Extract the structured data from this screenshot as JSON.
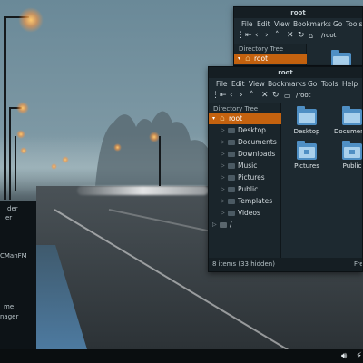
{
  "side_menu": {
    "items": [
      "der",
      "er",
      "CManFM",
      "me",
      "nager"
    ]
  },
  "window_back": {
    "title": "root",
    "menu": [
      "File",
      "Edit",
      "View",
      "Bookmarks",
      "Go",
      "Tools"
    ],
    "path": "/root",
    "pane_title": "Directory Tree",
    "tree_selected": "root"
  },
  "window_front": {
    "title": "root",
    "menu": [
      "File",
      "Edit",
      "View",
      "Bookmarks",
      "Go",
      "Tools",
      "Help"
    ],
    "path": "/root",
    "pane_title": "Directory Tree",
    "tree": [
      {
        "label": "root",
        "selected": true,
        "icon": "home-icon"
      },
      {
        "label": "Desktop",
        "icon": "folder-icon"
      },
      {
        "label": "Documents",
        "icon": "folder-icon"
      },
      {
        "label": "Downloads",
        "icon": "folder-icon"
      },
      {
        "label": "Music",
        "icon": "folder-icon"
      },
      {
        "label": "Pictures",
        "icon": "folder-icon"
      },
      {
        "label": "Public",
        "icon": "folder-icon"
      },
      {
        "label": "Templates",
        "icon": "folder-icon"
      },
      {
        "label": "Videos",
        "icon": "folder-icon"
      },
      {
        "label": "/",
        "icon": "drive-icon"
      }
    ],
    "files": [
      "Desktop",
      "Documents",
      "Pictures",
      "Public"
    ],
    "status_left": "8 items (33 hidden)",
    "status_right": "Fre"
  },
  "taskbar": {
    "icons": [
      "volume-icon",
      "power-icon"
    ]
  }
}
